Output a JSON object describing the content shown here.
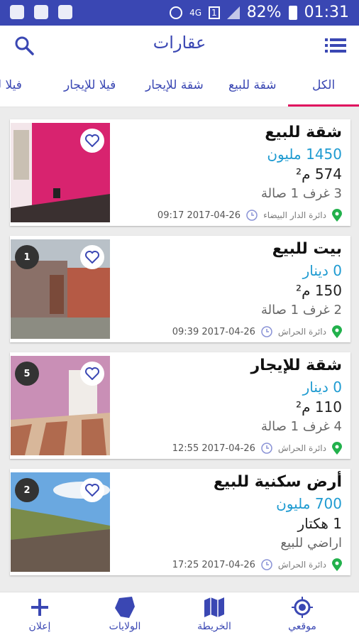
{
  "statusbar": {
    "network": "4G",
    "sim": "1",
    "battery": "82%",
    "time": "01:31"
  },
  "appbar": {
    "title": "عقارات"
  },
  "tabs": [
    {
      "label": "الكل"
    },
    {
      "label": "شقة للبيع"
    },
    {
      "label": "شقة للإيجار"
    },
    {
      "label": "فيلا للإيجار"
    },
    {
      "label": "فيلا للبيع"
    }
  ],
  "listings": [
    {
      "title": "شقة للبيع",
      "price": "1450 مليون",
      "area": "574 م²",
      "rooms": "3 غرف 1 صالة",
      "location": "دائرة الدار البيضاء",
      "datetime": "09:17 2017-04-26",
      "photo_count": ""
    },
    {
      "title": "بيت للبيع",
      "price": "0 دينار",
      "area": "150 م²",
      "rooms": "2 غرف 1 صالة",
      "location": "دائرة الحراش",
      "datetime": "09:39 2017-04-26",
      "photo_count": "1"
    },
    {
      "title": "شقة للإيجار",
      "price": "0 دينار",
      "area": "110 م²",
      "rooms": "4 غرف 1 صالة",
      "location": "دائرة الحراش",
      "datetime": "12:55 2017-04-26",
      "photo_count": "5"
    },
    {
      "title": "أرض سكنية للبيع",
      "price": "700 مليون",
      "area": "1 هكتار",
      "rooms": "اراضي للبيع",
      "location": "دائرة الحراش",
      "datetime": "17:25 2017-04-26",
      "photo_count": "2"
    }
  ],
  "bottomnav": [
    {
      "label": "إعلان",
      "icon": "plus-icon"
    },
    {
      "label": "الولايات",
      "icon": "algeria-map-icon"
    },
    {
      "label": "الخريطة",
      "icon": "map-icon"
    },
    {
      "label": "موقعي",
      "icon": "location-target-icon"
    }
  ],
  "colors": {
    "primary": "#3a47b3",
    "accent": "#e0115f",
    "price": "#1f9bd1",
    "location_pin": "#22b14c"
  }
}
